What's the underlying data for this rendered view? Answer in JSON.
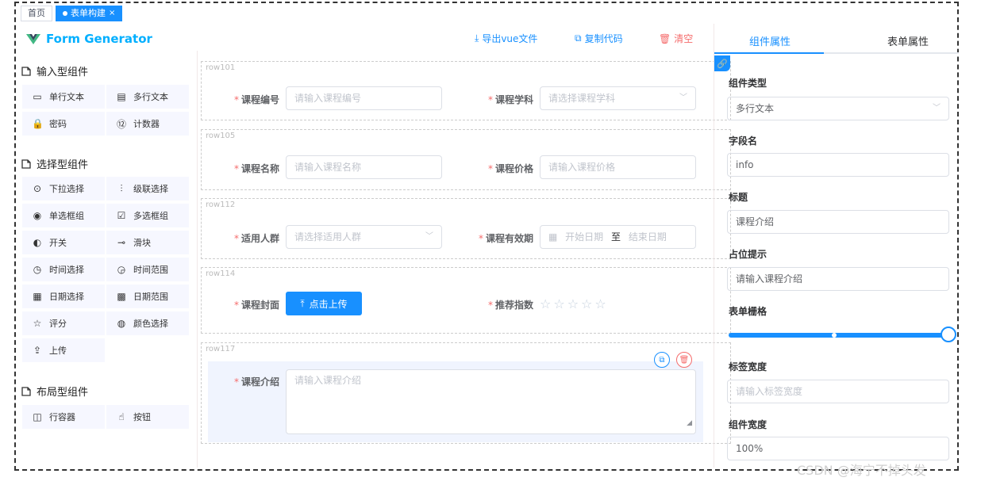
{
  "tabs": {
    "home": "首页",
    "active": "表单构建"
  },
  "brand": "Form Generator",
  "toolbar": {
    "export": "导出vue文件",
    "copy": "复制代码",
    "clear": "清空"
  },
  "groups": [
    {
      "title": "输入型组件",
      "items": [
        "单行文本",
        "多行文本",
        "密码",
        "计数器"
      ]
    },
    {
      "title": "选择型组件",
      "items": [
        "下拉选择",
        "级联选择",
        "单选框组",
        "多选框组",
        "开关",
        "滑块",
        "时间选择",
        "时间范围",
        "日期选择",
        "日期范围",
        "评分",
        "颜色选择",
        "上传"
      ]
    },
    {
      "title": "布局型组件",
      "items": [
        "行容器",
        "按钮"
      ]
    }
  ],
  "rows": [
    {
      "id": "row101",
      "fields": [
        {
          "label": "课程编号",
          "placeholder": "请输入课程编号"
        },
        {
          "label": "课程学科",
          "placeholder": "请选择课程学科"
        }
      ]
    },
    {
      "id": "row105",
      "fields": [
        {
          "label": "课程名称",
          "placeholder": "请输入课程名称"
        },
        {
          "label": "课程价格",
          "placeholder": "请输入课程价格"
        }
      ]
    },
    {
      "id": "row112",
      "fields": [
        {
          "label": "适用人群",
          "placeholder": "请选择适用人群"
        },
        {
          "label": "课程有效期",
          "start": "开始日期",
          "sep": "至",
          "end": "结束日期"
        }
      ]
    },
    {
      "id": "row114",
      "fields": [
        {
          "label": "课程封面",
          "button": "点击上传"
        },
        {
          "label": "推荐指数",
          "rating": 0,
          "max": 5
        }
      ]
    },
    {
      "id": "row117",
      "fields": [
        {
          "label": "课程介绍",
          "placeholder": "请输入课程介绍"
        }
      ]
    }
  ],
  "panel": {
    "tab_component": "组件属性",
    "tab_form": "表单属性",
    "type_label": "组件类型",
    "type_value": "多行文本",
    "field_label": "字段名",
    "field_value": "info",
    "title_label": "标题",
    "title_value": "课程介绍",
    "placeholder_label": "占位提示",
    "placeholder_value": "请输入课程介绍",
    "grid_label": "表单栅格",
    "grid_value": 24,
    "label_width_label": "标签宽度",
    "label_width_placeholder": "请输入标签宽度",
    "width_label": "组件宽度",
    "width_value": "100%"
  },
  "watermark": "CSDN @海宁不掉头发",
  "colors": {
    "primary": "#1890ff",
    "danger": "#f56c6c",
    "accent": "#00afff"
  }
}
